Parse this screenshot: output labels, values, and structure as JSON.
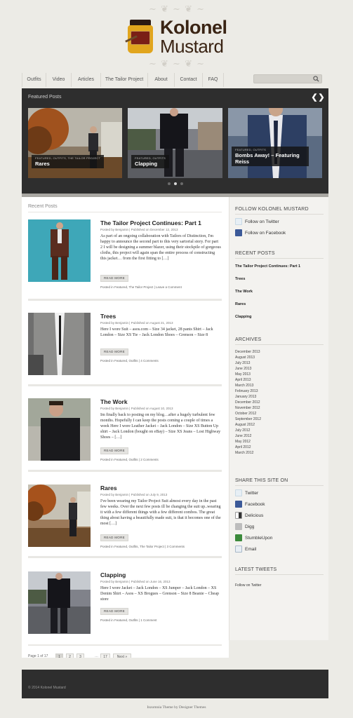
{
  "site": {
    "title_line1": "Kolonel",
    "title_line2": "Mustard",
    "ornament": "~ ❦ ~ ❦ ~"
  },
  "nav": {
    "items": [
      "Outfits",
      "Video",
      "Articles",
      "The Tailor Project",
      "About",
      "Contact",
      "FAQ"
    ]
  },
  "featured": {
    "title": "Featured Posts",
    "prev": "❮",
    "next": "❯",
    "slides": [
      {
        "cats": "FEATURED, OUTFITS, THE TAILOR PROJECT",
        "title": "Rares"
      },
      {
        "cats": "FEATURED, OUTFITS",
        "title": "Clapping"
      },
      {
        "cats": "FEATURED, OUTFITS",
        "title": "Bombs Away! – Featuring Reiss"
      }
    ]
  },
  "recent": {
    "title": "Recent Posts",
    "read_more": "READ MORE",
    "posts": [
      {
        "title": "The Tailor Project Continues: Part 1",
        "meta": "Posted by Benjamin | Published on December 12, 2013",
        "excerpt": "As part of an ongoing collaboration with Tailors of Distinction, I'm happy to announce the second part to this very sartorial story. For part 2 I will be designing a summer blazer, using their stockpile of gorgeous cloths, this project will again span the entire process of constructing this jacket… from the first fitting to […]",
        "tags": "Posted in Featured, The Tailor Project | Leave a Comment"
      },
      {
        "title": "Trees",
        "meta": "Posted by Benjamin | Published on August 21, 2013",
        "excerpt": "Here I wore Suit – asos.com – Size 34 jacket, 28 pants Shirt – Jack London – Size XS Tie – Jack London Shoes – Grenson – Size 8",
        "tags": "Posted in Featured, Outfits | 4 Comments"
      },
      {
        "title": "The Work",
        "meta": "Posted by Benjamin | Published on August 10, 2013",
        "excerpt": "Im finally back to posting on my blog…after a hugely turbulent few months. Hopefully I can keep the posts coming a couple of times a week Here I wore Leather Jacket – Jack London – Size XS Button Up shirt – Jack London (bought on eBay) – Size XS Jeans – Lost Highway Shoes – […]",
        "tags": "Posted in Featured, Outfits | 2 Comments"
      },
      {
        "title": "Rares",
        "meta": "Posted by Benjamin | Published on July 9, 2013",
        "excerpt": "I've been wearing my Tailor Project Suit almost every day in the past few weeks. Over the next few posts ill be changing the suit up..wearing it with a few different things with a few different combos. The great thing about having a beautifully made suit, is that it becomes one of the most […]",
        "tags": "Posted in Featured, Outfits, The Tailor Project | 3 Comments"
      },
      {
        "title": "Clapping",
        "meta": "Posted by Benjamin | Published on June 16, 2013",
        "excerpt": "Here I wore Jacket – Jack London – XS Jumper – Jack London – XS Denim Shirt – Asos – XS Brogues – Grenson – Size 8 Beanie – Cheap store",
        "tags": "Posted in Featured, Outfits | 1 Comment"
      }
    ]
  },
  "pagination": {
    "page_of": "Page 1 of 17",
    "pages": [
      "1",
      "2",
      "3"
    ],
    "ellipsis": "…",
    "last": "17",
    "next": "Next »"
  },
  "sidebar": {
    "follow": {
      "title": "FOLLOW KOLONEL MUSTARD",
      "twitter": "Follow on Twitter",
      "facebook": "Follow on Facebook"
    },
    "recent_posts": {
      "title": "RECENT POSTS",
      "items": [
        "The Tailor Project Continues: Part 1",
        "Trees",
        "The Work",
        "Rares",
        "Clapping"
      ]
    },
    "archives": {
      "title": "ARCHIVES",
      "items": [
        "December 2013",
        "August 2013",
        "July 2013",
        "June 2013",
        "May 2013",
        "April 2013",
        "March 2013",
        "February 2013",
        "January 2013",
        "December 2012",
        "November 2012",
        "October 2012",
        "September 2012",
        "August 2012",
        "July 2012",
        "June 2012",
        "May 2012",
        "April 2012",
        "March 2012"
      ]
    },
    "share": {
      "title": "SHARE THIS SITE ON",
      "items": [
        "Twitter",
        "Facebook",
        "Delicious",
        "Digg",
        "StumbleUpon",
        "Email"
      ]
    },
    "tweets": {
      "title": "LATEST TWEETS",
      "follow": "Follow on Twitter"
    }
  },
  "footer": {
    "copyright": "© 2014 Kolonel Mustard",
    "credit": "Inzomnia Theme by Designer Themes"
  },
  "colors": {
    "accent": "#3a2414",
    "mustard": "#e1a51d",
    "dark": "#2e2e2e",
    "bg": "#ecebe6"
  }
}
